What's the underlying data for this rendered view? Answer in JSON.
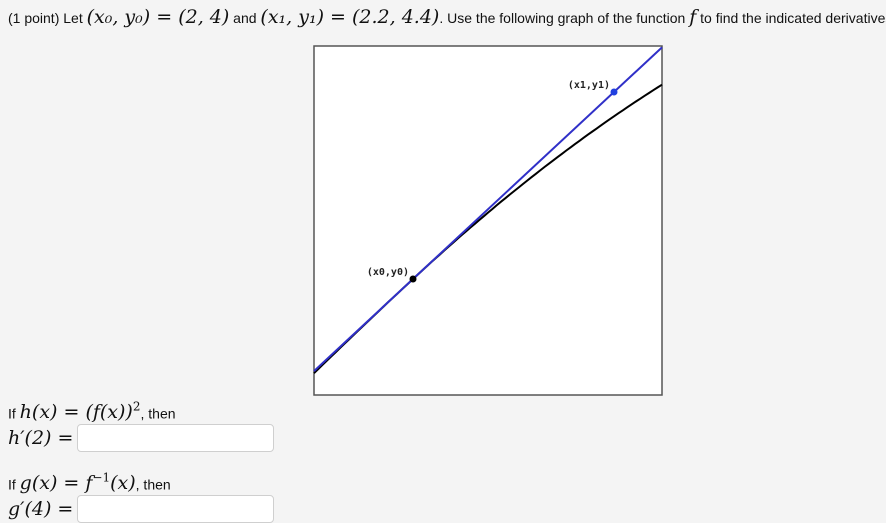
{
  "problem": {
    "points_label": "(1 point) Let",
    "p0_expr": "(x₀, y₀) = (2, 4)",
    "and_text": "and",
    "p1_expr": "(x₁, y₁) = (2.2, 4.4)",
    "instruction_pre": ". Use the following graph of the function",
    "function_symbol": "f",
    "instruction_post": "to find the indicated derivatives."
  },
  "chart_data": {
    "type": "line",
    "title": "",
    "xlabel": "",
    "ylabel": "",
    "grid": false,
    "series": [
      {
        "name": "f(x)",
        "color": "#000000",
        "description": "concave-down curve passing through (x0,y0)"
      },
      {
        "name": "tangent line at (x0,y0)",
        "color": "#3030c8",
        "description": "straight line through (x0,y0) and (x1,y1)"
      }
    ],
    "points": [
      {
        "label": "(x0,y0)",
        "x": 2,
        "y": 4,
        "color": "#000000"
      },
      {
        "label": "(x1,y1)",
        "x": 2.2,
        "y": 4.4,
        "color": "#2040e0"
      }
    ]
  },
  "questions": [
    {
      "if_text": "If",
      "definition": "h(x) = (f(x))",
      "definition_sup": "2",
      "then_text": ", then",
      "prompt": "h′(2) =",
      "value": "",
      "placeholder": ""
    },
    {
      "if_text": "If",
      "definition": "g(x) = f",
      "definition_sup": "−1",
      "definition_tail": "(x)",
      "then_text": ", then",
      "prompt": "g′(4) =",
      "value": "",
      "placeholder": ""
    }
  ]
}
